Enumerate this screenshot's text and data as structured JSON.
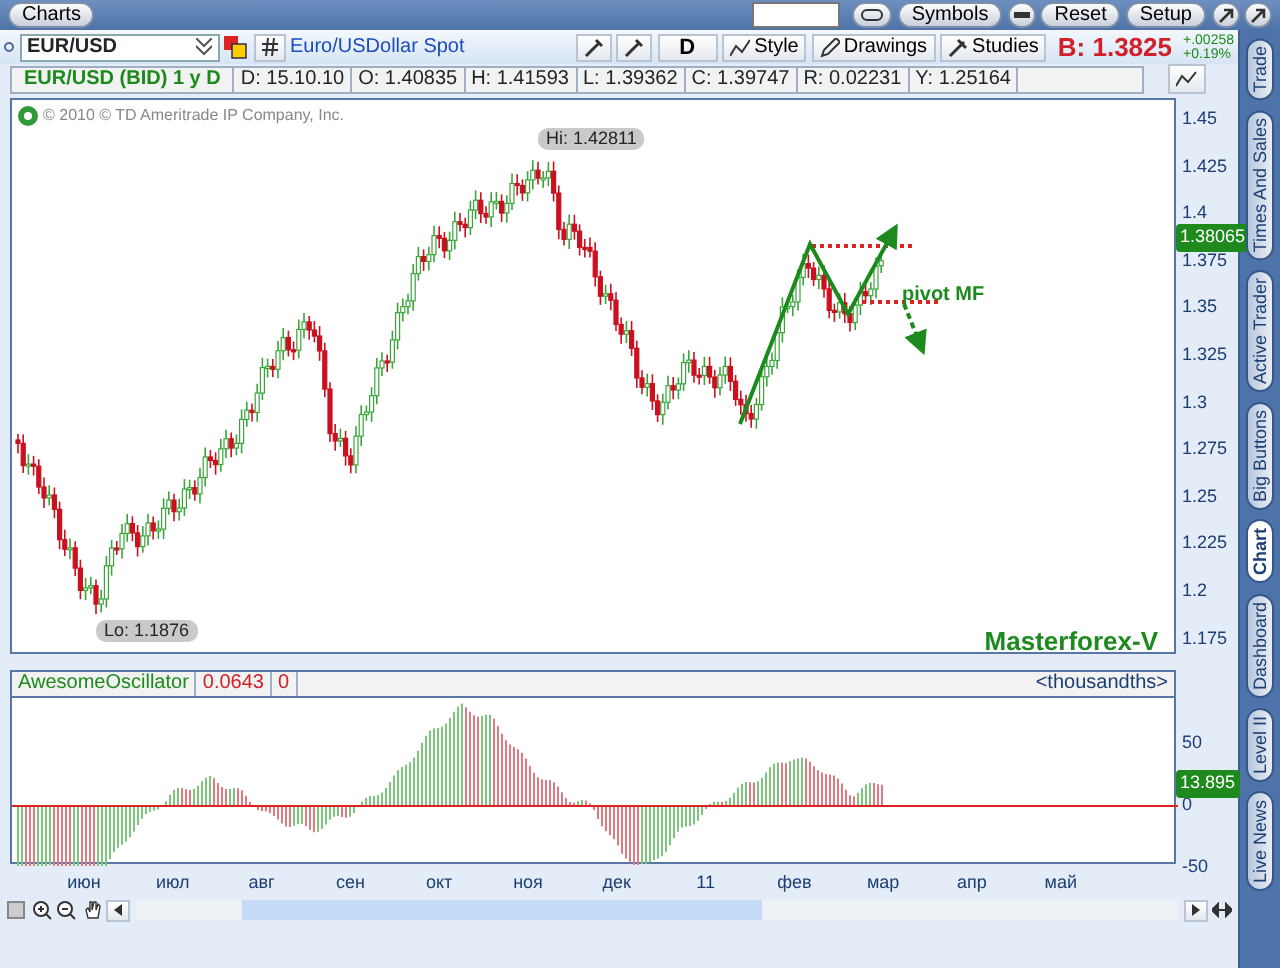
{
  "top_bar": {
    "tab": "Charts",
    "buttons": [
      "Symbols",
      "Reset",
      "Setup"
    ]
  },
  "symbol_bar": {
    "symbol": "EUR/USD",
    "description": "Euro/USDollar Spot",
    "period": "D",
    "menus": [
      "Style",
      "Drawings",
      "Studies"
    ],
    "bid": "B: 1.3825",
    "change": "+.00258",
    "change_pct": "+0.19%"
  },
  "info_strip": {
    "title": "EUR/USD (BID) 1 y D",
    "cells": [
      "D: 15.10.10",
      "O: 1.40835",
      "H: 1.41593",
      "L: 1.39362",
      "C: 1.39747",
      "R: 0.02231",
      "Y: 1.25164"
    ]
  },
  "price_chart": {
    "copyright": "© 2010 © TD Ameritrade IP Company, Inc.",
    "high_label": "Hi: 1.42811",
    "low_label": "Lo: 1.1876",
    "signature": "Masterforex-V",
    "pivot_label": "pivot MF",
    "last_price": "1.38065",
    "ticks": [
      "1.45",
      "1.425",
      "1.4",
      "1.375",
      "1.35",
      "1.325",
      "1.3",
      "1.275",
      "1.25",
      "1.225",
      "1.2",
      "1.175"
    ]
  },
  "oscillator": {
    "name": "AwesomeOscillator",
    "value": "0.0643",
    "value_2": "0",
    "units": "<thousandths>",
    "last_value": "13.895",
    "ticks": [
      "50",
      "0",
      "-50"
    ]
  },
  "time_axis": [
    "июн",
    "июл",
    "авг",
    "сен",
    "окт",
    "ноя",
    "дек",
    "11",
    "фев",
    "мар",
    "апр",
    "май"
  ],
  "side_tabs": [
    {
      "label": "Trade",
      "selected": false
    },
    {
      "label": "Times And Sales",
      "selected": false
    },
    {
      "label": "Active Trader",
      "selected": false
    },
    {
      "label": "Big Buttons",
      "selected": false
    },
    {
      "label": "Chart",
      "selected": true
    },
    {
      "label": "Dashboard",
      "selected": false
    },
    {
      "label": "Level II",
      "selected": false
    },
    {
      "label": "Live News",
      "selected": false
    }
  ]
}
